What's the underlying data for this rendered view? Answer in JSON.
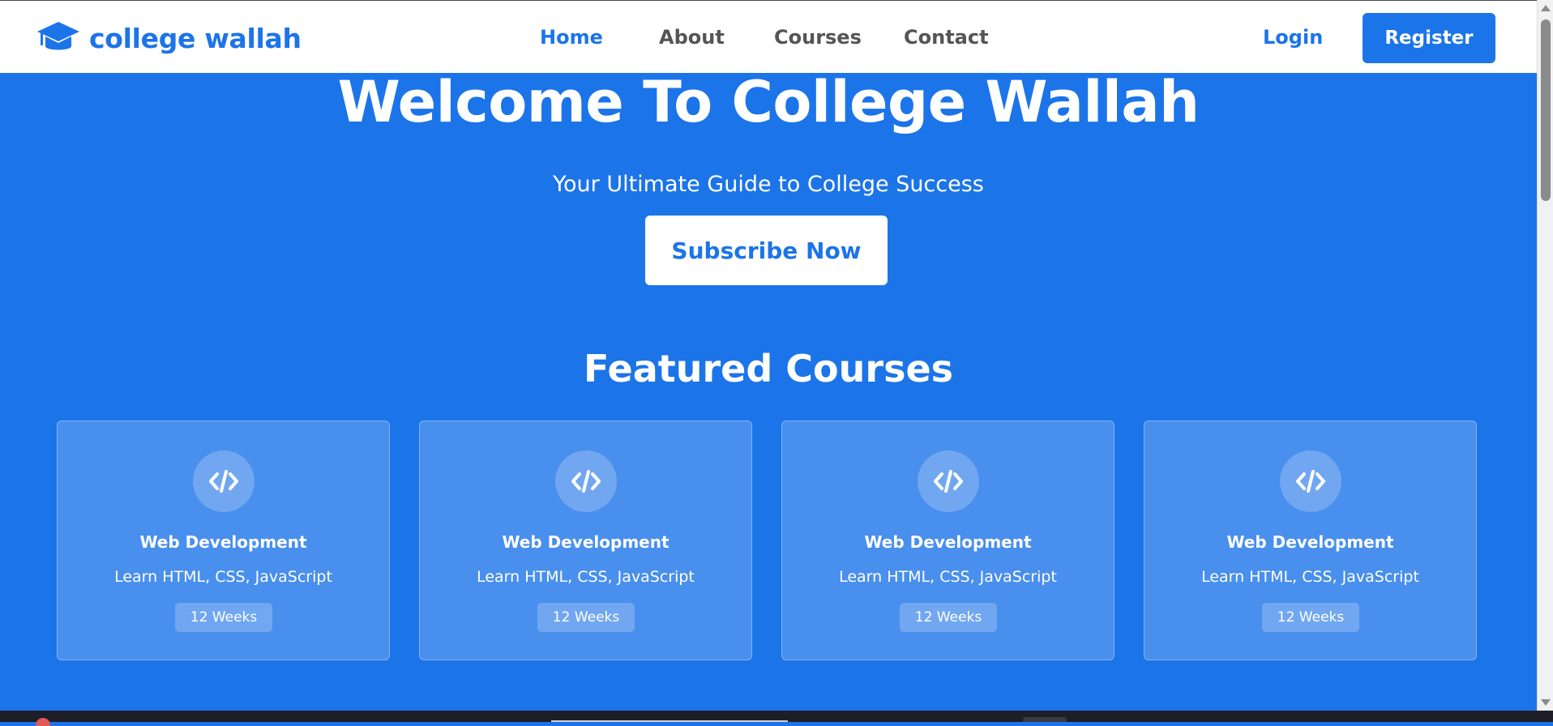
{
  "navbar": {
    "brand_name": "college wallah",
    "brand_icon": "graduation-cap-icon",
    "links": [
      {
        "label": "Home",
        "active": true
      },
      {
        "label": "About",
        "active": false
      },
      {
        "label": "Courses",
        "active": false
      },
      {
        "label": "Contact",
        "active": false
      }
    ],
    "login_label": "Login",
    "register_label": "Register"
  },
  "hero": {
    "title": "Welcome To College Wallah",
    "subtitle": "Your Ultimate Guide to College Success",
    "cta_label": "Subscribe Now"
  },
  "featured": {
    "title": "Featured Courses",
    "courses": [
      {
        "icon": "code-icon",
        "title": "Web Development",
        "description": "Learn HTML, CSS, JavaScript",
        "duration": "12 Weeks"
      },
      {
        "icon": "code-icon",
        "title": "Web Development",
        "description": "Learn HTML, CSS, JavaScript",
        "duration": "12 Weeks"
      },
      {
        "icon": "code-icon",
        "title": "Web Development",
        "description": "Learn HTML, CSS, JavaScript",
        "duration": "12 Weeks"
      },
      {
        "icon": "code-icon",
        "title": "Web Development",
        "description": "Learn HTML, CSS, JavaScript",
        "duration": "12 Weeks"
      }
    ]
  },
  "colors": {
    "primary": "#1c74e9",
    "nav_text": "#555555",
    "white": "#ffffff"
  }
}
